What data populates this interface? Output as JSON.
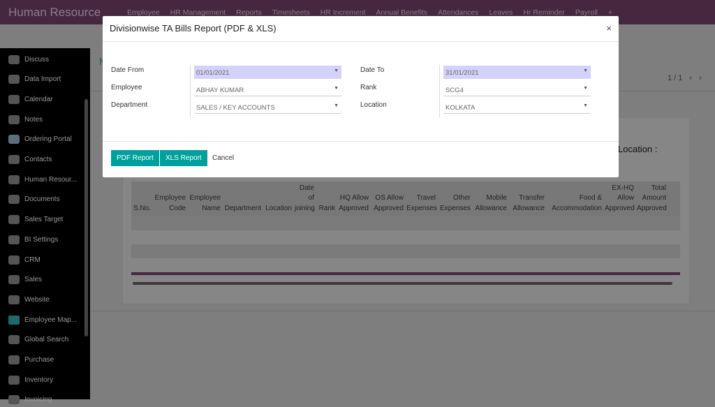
{
  "app": {
    "title": "Human Resource"
  },
  "menu": [
    "Employee",
    "HR Management",
    "Reports",
    "Timesheets",
    "HR Increment",
    "Annual Benefits",
    "Attendances",
    "Leaves",
    "Hr Reminder",
    "Payroll",
    "+"
  ],
  "breadcrumb": "M",
  "pager": {
    "text": "1 / 1",
    "prev": "‹",
    "next": "›"
  },
  "sidebar": {
    "items": [
      {
        "label": "Discuss",
        "icon": "app-icon"
      },
      {
        "label": "Data Import",
        "icon": "app-icon"
      },
      {
        "label": "Calendar",
        "icon": "app-icon"
      },
      {
        "label": "Notes",
        "icon": "app-icon"
      },
      {
        "label": "Ordering Portal",
        "icon": "portal-icon"
      },
      {
        "label": "Contacts",
        "icon": "app-icon"
      },
      {
        "label": "Human Resour...",
        "icon": "app-icon"
      },
      {
        "label": "Documents",
        "icon": "app-icon"
      },
      {
        "label": "Sales Target",
        "icon": "app-icon"
      },
      {
        "label": "BI Settings",
        "icon": "app-icon"
      },
      {
        "label": "CRM",
        "icon": "app-icon"
      },
      {
        "label": "Sales",
        "icon": "app-icon"
      },
      {
        "label": "Website",
        "icon": "app-icon"
      },
      {
        "label": "Employee Map...",
        "icon": "map-pin-icon"
      },
      {
        "label": "Global Search",
        "icon": "app-icon"
      },
      {
        "label": "Purchase",
        "icon": "app-icon"
      },
      {
        "label": "Inventory",
        "icon": "app-icon"
      },
      {
        "label": "Invoicing",
        "icon": "app-icon"
      }
    ]
  },
  "report": {
    "location_label": "Location :",
    "columns": [
      "S.No.",
      "Employee Code",
      "Employee Name",
      "Department",
      "Location",
      "Date of joining",
      "Rank",
      "HQ Allow Approved",
      "OS Allow Approved",
      "Travel Expenses",
      "Other Expenses",
      "Mobile Allowance",
      "Transfer Allowance",
      "Food & Accommodation",
      "EX-HQ Allow Approved",
      "Total Amount Approved"
    ]
  },
  "modal": {
    "title": "Divisionwise TA Bills Report (PDF & XLS)",
    "close": "×",
    "fields": {
      "date_from": {
        "label": "Date From",
        "value": "01/01/2021"
      },
      "employee": {
        "label": "Employee",
        "value": "ABHAY KUMAR"
      },
      "department": {
        "label": "Department",
        "value": "SALES / KEY ACCOUNTS"
      },
      "date_to": {
        "label": "Date To",
        "value": "31/01/2021"
      },
      "rank": {
        "label": "Rank",
        "value": "SCG4"
      },
      "location": {
        "label": "Location",
        "value": "KOLKATA"
      }
    },
    "pdf_button": "PDF Report",
    "xls_button": "XLS Report",
    "cancel": "Cancel"
  },
  "colors": {
    "navbar": "#45283f",
    "primary": "#00a09d",
    "required_field": "#d2d2fb"
  }
}
